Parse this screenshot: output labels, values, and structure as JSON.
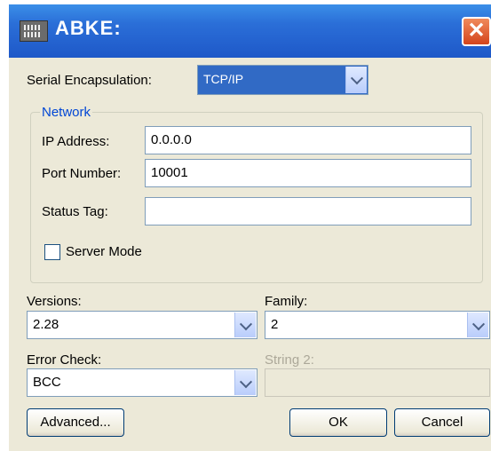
{
  "window": {
    "title": "ABKE:"
  },
  "serial": {
    "label": "Serial Encapsulation:",
    "value": "TCP/IP"
  },
  "network": {
    "group_label": "Network",
    "ip_label": "IP Address:",
    "ip_value": "0.0.0.0",
    "port_label": "Port Number:",
    "port_value": "10001",
    "status_label": "Status Tag:",
    "status_value": "",
    "server_mode_label": "Server Mode",
    "server_mode_checked": false
  },
  "versions": {
    "label": "Versions:",
    "value": "2.28"
  },
  "family": {
    "label": "Family:",
    "value": "2"
  },
  "error_check": {
    "label": "Error Check:",
    "value": "BCC"
  },
  "string2": {
    "label": "String 2:",
    "value": ""
  },
  "buttons": {
    "advanced": "Advanced...",
    "ok": "OK",
    "cancel": "Cancel"
  }
}
